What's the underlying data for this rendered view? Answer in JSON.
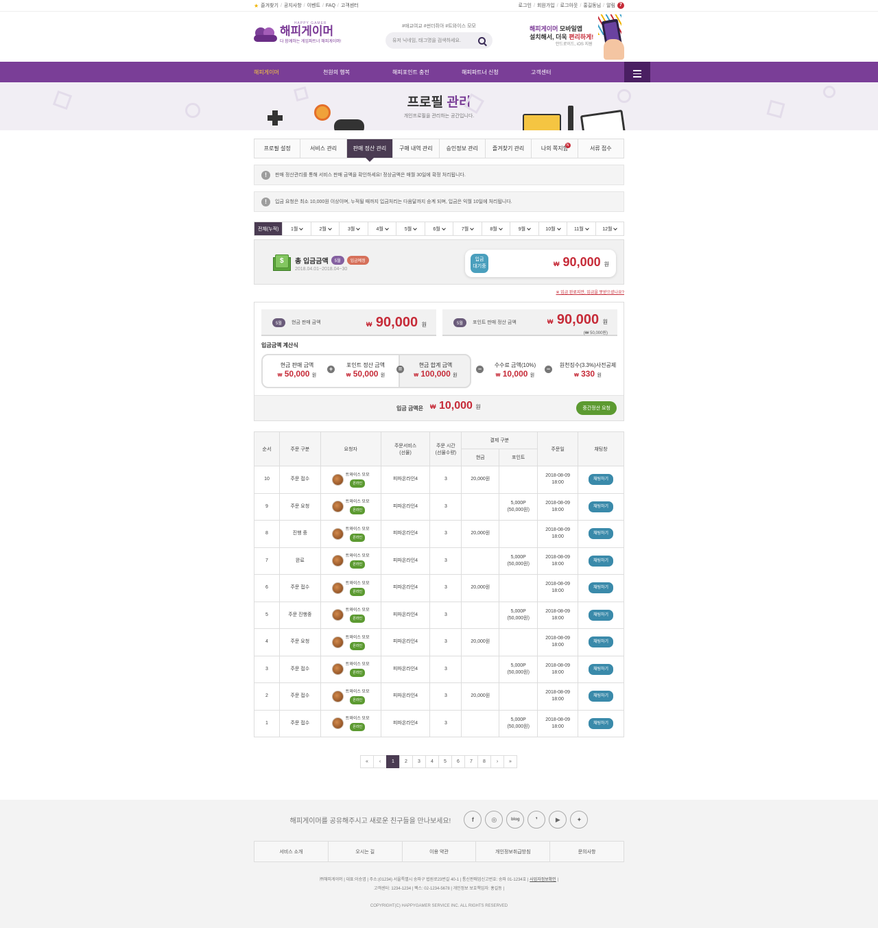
{
  "topbar": {
    "left": [
      "즐겨찾기",
      "공지사항",
      "이벤트",
      "FAQ",
      "고객센터"
    ],
    "right": [
      "로그인",
      "회원가입",
      "로그아웃",
      "홍길동님",
      "알림"
    ],
    "alarm_count": "7"
  },
  "header": {
    "logo_small": "HAPPY GAMER",
    "logo_name": "해피게이머",
    "logo_sub": "다 함께하는 게임파트너 해피게이머!",
    "search_tags": "#애교여교 #썬더쥐아 #트와이스 모모",
    "search_placeholder": "유저 닉네임, 태그명을 검색하세요.",
    "app_t1_a": "해피게이머",
    "app_t1_b": "모바일앱",
    "app_t2_a": "설치해서, 더욱 ",
    "app_t2_b": "편리하게!",
    "app_t3": "안드로이드, iOS 지원"
  },
  "nav": [
    "해피게이머",
    "천원의 행복",
    "해피포인트 충전",
    "해피파트너 신청",
    "고객센터"
  ],
  "banner": {
    "title_a": "프로필 ",
    "title_b": "관리",
    "sub": "개인프로필을 관리하는 공간입니다."
  },
  "tabs": [
    "프로필 설정",
    "서비스 관리",
    "판매 정산 관리",
    "구매 내역 관리",
    "승인정보 관리",
    "즐겨찾기 관리",
    "나의 쪽지함",
    "서류 접수"
  ],
  "tab_new": "N",
  "notices": [
    "판매 정산관리를 통해 서비스 판매 금액을 확인하세요! 정상금액은 매월 30일에 확정 처리됩니다.",
    "입금 요청은 최소 10,000원 이상이며, 누적될 때까지 입금처리는 다음달까지 승계 되며, 입금은 익월 10일에 처리됩니다."
  ],
  "months": [
    "전체(누적)",
    "1월",
    "2월",
    "3월",
    "4월",
    "5월",
    "6월",
    "7월",
    "8월",
    "9월",
    "10월",
    "11월",
    "12월"
  ],
  "total": {
    "label": "총 입금금액",
    "month_pill": "5월",
    "status_pill": "입금예정",
    "date": "2018.04.01~2018.04~30",
    "state_a": "입금",
    "state_b": "대기중",
    "currency": "₩",
    "amount": "90,000",
    "unit": "원"
  },
  "link_red": "※ 입금 완료지만, 입금을 못받으셨나요?",
  "calc": {
    "cash": {
      "pill": "5월",
      "label": "현금 판매 금액",
      "amount": "90,000"
    },
    "point": {
      "pill": "5월",
      "label": "포인트 판매 정산 금액",
      "amount": "90,000",
      "sub": "(₩ 50,000원)"
    },
    "formula_title": "입금금액 계산식",
    "items": [
      {
        "label": "현금 판매 금액",
        "amount": "50,000"
      },
      {
        "label": "포인트 정산 금액",
        "amount": "50,000"
      },
      {
        "label": "현금 합계 금액",
        "amount": "100,000"
      },
      {
        "label": "수수료 금액(10%)",
        "amount": "10,000"
      },
      {
        "label": "원천징수(3.3%)사전공제",
        "amount": "330"
      }
    ],
    "ops": [
      "+",
      "=",
      "−",
      "−"
    ],
    "foot_label": "입금 금액은",
    "foot_amount": "10,000",
    "button": "중간정산 요청"
  },
  "table": {
    "headers": [
      "순서",
      "주문 구분",
      "요청자",
      "주문서비스\n(선물)",
      "주문 시간\n(선물수량)",
      "결제 구분",
      "주문일",
      "채팅창"
    ],
    "sub_headers": [
      "현금",
      "포인트"
    ],
    "rows": [
      {
        "no": "10",
        "type": "주문 접수",
        "name": "트와이스 모모",
        "status": "온라인",
        "service": "피파온라인4",
        "qty": "3",
        "cash": "20,000원",
        "point": "",
        "point_sub": "",
        "date": "2018-08-09",
        "time": "18:00",
        "chat": "채팅하기"
      },
      {
        "no": "9",
        "type": "주문 요청",
        "name": "트와이스 모모",
        "status": "온라인",
        "service": "피파온라인4",
        "qty": "3",
        "cash": "",
        "point": "5,000P",
        "point_sub": "(50,000원)",
        "date": "2018-08-09",
        "time": "18:00",
        "chat": "채팅하기"
      },
      {
        "no": "8",
        "type": "진행 중",
        "name": "트와이스 모모",
        "status": "온라인",
        "service": "피파온라인4",
        "qty": "3",
        "cash": "20,000원",
        "point": "",
        "point_sub": "",
        "date": "2018-08-09",
        "time": "18:00",
        "chat": "채팅하기"
      },
      {
        "no": "7",
        "type": "완료",
        "name": "트와이스 모모",
        "status": "온라인",
        "service": "피파온라인4",
        "qty": "3",
        "cash": "",
        "point": "5,000P",
        "point_sub": "(50,000원)",
        "date": "2018-08-09",
        "time": "18:00",
        "chat": "채팅하기"
      },
      {
        "no": "6",
        "type": "주문 접수",
        "name": "트와이스 모모",
        "status": "온라인",
        "service": "피파온라인4",
        "qty": "3",
        "cash": "20,000원",
        "point": "",
        "point_sub": "",
        "date": "2018-08-09",
        "time": "18:00",
        "chat": "채팅하기"
      },
      {
        "no": "5",
        "type": "주문 진행중",
        "name": "트와이스 모모",
        "status": "온라인",
        "service": "피파온라인4",
        "qty": "3",
        "cash": "",
        "point": "5,000P",
        "point_sub": "(50,000원)",
        "date": "2018-08-09",
        "time": "18:00",
        "chat": "채팅하기"
      },
      {
        "no": "4",
        "type": "주문 요청",
        "name": "트와이스 모모",
        "status": "온라인",
        "service": "피파온라인4",
        "qty": "3",
        "cash": "20,000원",
        "point": "",
        "point_sub": "",
        "date": "2018-08-09",
        "time": "18:00",
        "chat": "채팅하기"
      },
      {
        "no": "3",
        "type": "주문 접수",
        "name": "트와이스 모모",
        "status": "온라인",
        "service": "피파온라인4",
        "qty": "3",
        "cash": "",
        "point": "5,000P",
        "point_sub": "(50,000원)",
        "date": "2018-08-09",
        "time": "18:00",
        "chat": "채팅하기"
      },
      {
        "no": "2",
        "type": "주문 접수",
        "name": "트와이스 모모",
        "status": "온라인",
        "service": "피파온라인4",
        "qty": "3",
        "cash": "20,000원",
        "point": "",
        "point_sub": "",
        "date": "2018-08-09",
        "time": "18:00",
        "chat": "채팅하기"
      },
      {
        "no": "1",
        "type": "주문 접수",
        "name": "트와이스 모모",
        "status": "온라인",
        "service": "피파온라인4",
        "qty": "3",
        "cash": "",
        "point": "5,000P",
        "point_sub": "(50,000원)",
        "date": "2018-08-09",
        "time": "18:00",
        "chat": "채팅하기"
      }
    ]
  },
  "pager": [
    "«",
    "‹",
    "1",
    "2",
    "3",
    "4",
    "5",
    "6",
    "7",
    "8",
    "›",
    "»"
  ],
  "pager_active": "1",
  "footer": {
    "share": "해피게이머를 공유해주시고 새로운 친구들을 만나보세요!",
    "social": [
      "f",
      "◎",
      "blog",
      "❜",
      "▶",
      "✦"
    ],
    "social_names": [
      "facebook-icon",
      "instagram-icon",
      "blog-icon",
      "kakao-icon",
      "youtube-icon",
      "twitter-icon"
    ],
    "menu": [
      "서비스 소개",
      "오시는 길",
      "이용 약관",
      "개인정보취급방침",
      "문의사항"
    ],
    "info1": "㈜해피게이머 | 대표:이승엽 | 주소:(01234) 서울특별시 송파구 법원로23번길 40-1 | 통신판매업신고번호: 송파 01-1234호 | ",
    "info1_link": "사업자정보확인",
    "info2": "고객센터: 1234-1234 | 팩스: 02-1234-5678 | 개인정보 보호책임자: 홍길동 |",
    "copyright": "COPYRIGHT(C) HAPPYGAMER SERVICE INC. ALL RIGHTS RESERVED"
  },
  "colors": {
    "purple": "#7a3e97",
    "dark": "#4a3b52",
    "red": "#c62b38",
    "green": "#5c9a31",
    "blue": "#3a8aaa"
  }
}
